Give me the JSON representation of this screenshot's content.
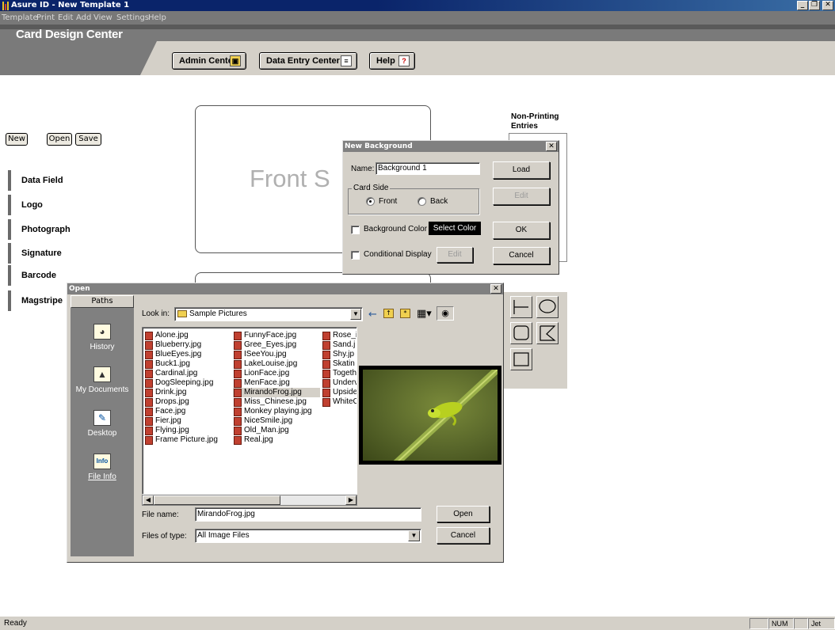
{
  "window": {
    "title": "Asure ID - New Template 1"
  },
  "menu": [
    "Template",
    "Print",
    "Edit",
    "Add",
    "View",
    "Settings",
    "Help"
  ],
  "header": {
    "title": "Card Design Center",
    "admin_label": "Admin Center",
    "data_entry_label": "Data Entry Center",
    "help_label": "Help"
  },
  "file_buttons": {
    "new": "New",
    "open": "Open",
    "save": "Save"
  },
  "sidebar": {
    "items": [
      {
        "label": "Data Field"
      },
      {
        "label": "Logo"
      },
      {
        "label": "Photograph"
      },
      {
        "label": "Signature"
      },
      {
        "label": "Barcode"
      },
      {
        "label": "Magstripe"
      }
    ]
  },
  "canvas": {
    "front_text": "Front S",
    "non_printing_label": "Non-Printing Entries"
  },
  "new_background": {
    "title": "New Background",
    "name_label": "Name:",
    "name_value": "Background 1",
    "card_side_label": "Card Side",
    "front_label": "Front",
    "back_label": "Back",
    "selected_side": "Front",
    "bg_color_label": "Background Color",
    "select_color_label": "Select Color",
    "conditional_label": "Conditional Display",
    "edit_label": "Edit",
    "load_label": "Load",
    "edit_btn_label": "Edit",
    "ok_label": "OK",
    "cancel_label": "Cancel"
  },
  "open_dialog": {
    "title": "Open",
    "paths_label": "Paths",
    "paths": [
      {
        "label": "History",
        "icon": "history-icon"
      },
      {
        "label": "My Documents",
        "icon": "my-documents-icon"
      },
      {
        "label": "Desktop",
        "icon": "desktop-icon"
      },
      {
        "label": "File Info",
        "icon": "file-info-icon"
      }
    ],
    "look_in_label": "Look in:",
    "look_in_value": "Sample Pictures",
    "files_col1": [
      "Alone.jpg",
      "Blueberry.jpg",
      "BlueEyes.jpg",
      "Buck1.jpg",
      "Cardinal.jpg",
      "DogSleeping.jpg",
      "Drink.jpg",
      "Drops.jpg",
      "Face.jpg",
      "Fier.jpg",
      "Flying.jpg",
      "Frame Picture.jpg"
    ],
    "files_col2": [
      "FunnyFace.jpg",
      "Gree_Eyes.jpg",
      "ISeeYou.jpg",
      "LakeLouise.jpg",
      "LionFace.jpg",
      "MenFace.jpg",
      "MirandoFrog.jpg",
      "Miss_Chinese.jpg",
      "Monkey playing.jpg",
      "NiceSmile.jpg",
      "Old_Man.jpg",
      "Real.jpg"
    ],
    "files_col3": [
      "Rose_i",
      "Sand.j",
      "Shy.jp",
      "Skatin",
      "Togeth",
      "Underv",
      "Upside",
      "WhiteC"
    ],
    "selected_file": "MirandoFrog.jpg",
    "file_name_label": "File name:",
    "file_name_value": "MirandoFrog.jpg",
    "files_of_type_label": "Files of type:",
    "files_of_type_value": "All Image Files",
    "open_label": "Open",
    "cancel_label": "Cancel"
  },
  "status": {
    "text": "Ready",
    "num": "NUM",
    "printer": "Jet"
  }
}
